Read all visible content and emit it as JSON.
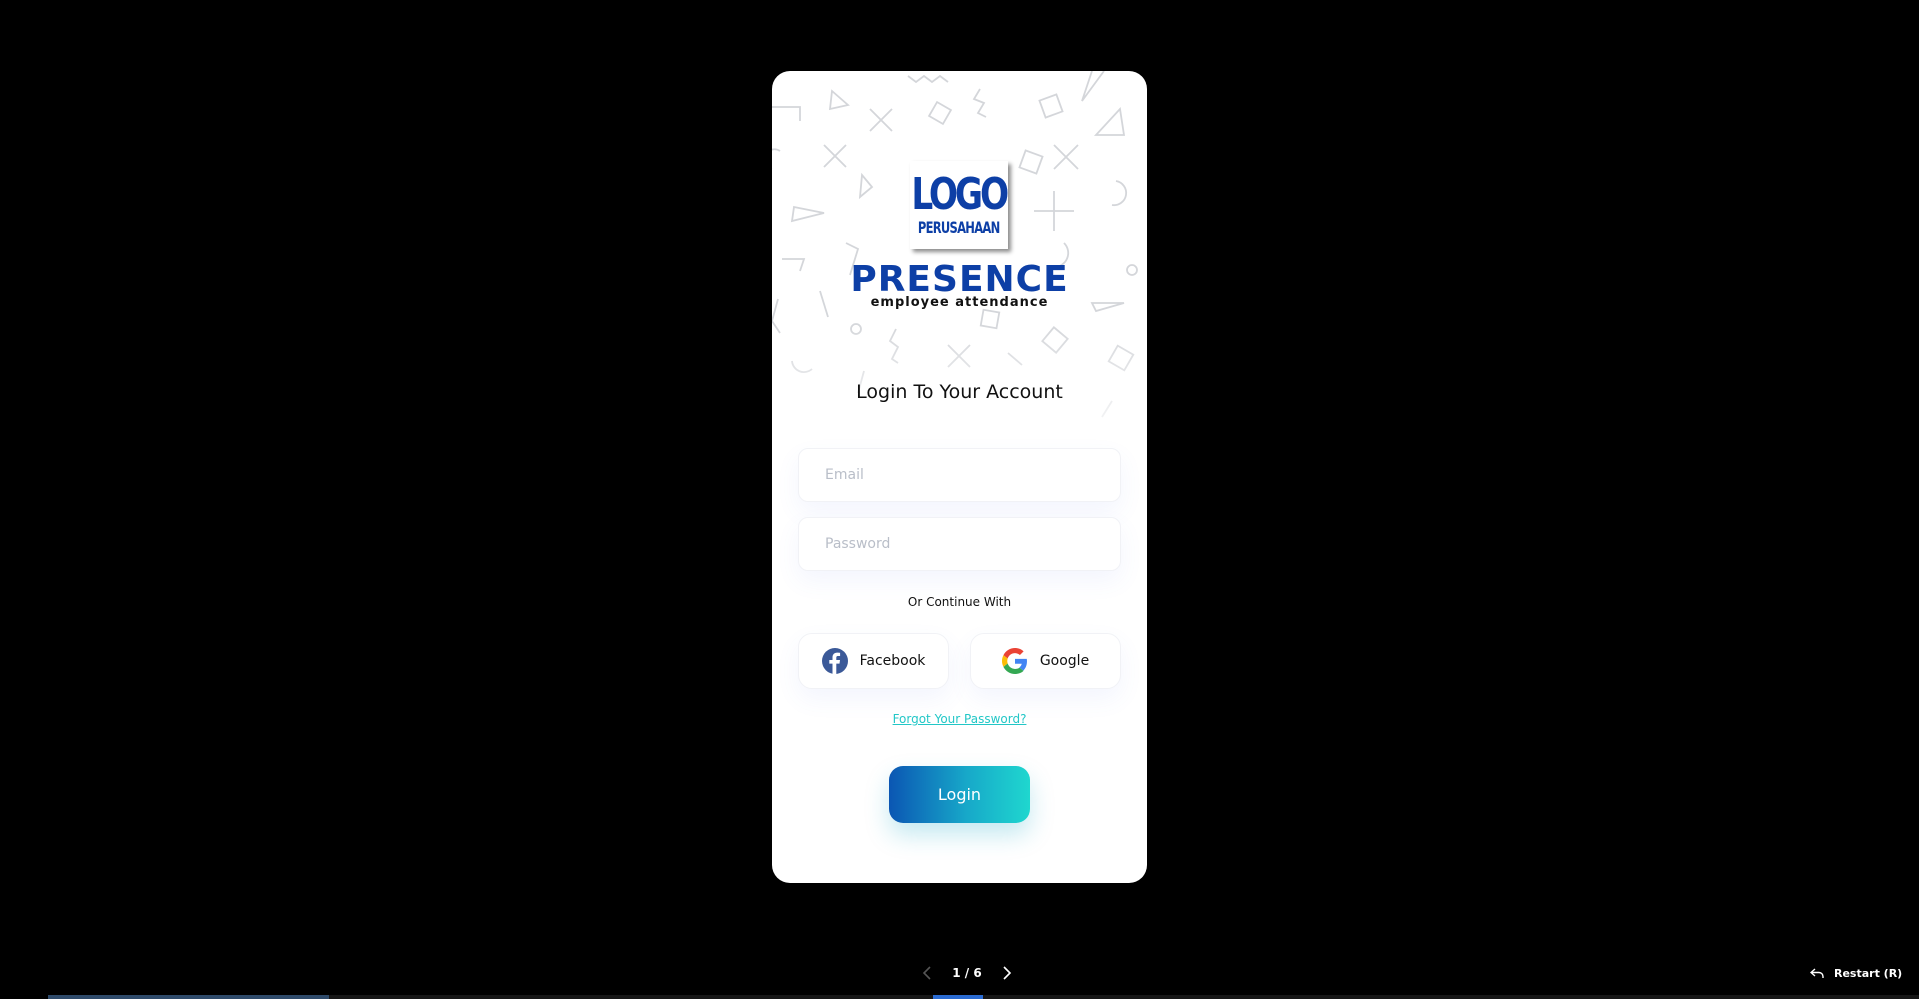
{
  "app": {
    "brand_name": "PRESENCE",
    "brand_tagline": "employee attendance",
    "logo_main": "LOGO",
    "logo_sub": "PERUSAHAAN"
  },
  "login": {
    "heading": "Login To Your Account",
    "email_placeholder": "Email",
    "password_placeholder": "Password",
    "divider_text": "Or Continue With",
    "facebook_label": "Facebook",
    "google_label": "Google",
    "forgot_password": "Forgot Your Password?",
    "login_label": "Login"
  },
  "viewer": {
    "page_indicator": "1 / 6",
    "restart_label": "Restart (R)",
    "progress_fraction": 0.15
  },
  "colors": {
    "brand": "#0d3fa6",
    "accent": "#22c7c7",
    "button_gradient_start": "#0b56b3",
    "button_gradient_end": "#1fd7cf",
    "facebook": "#3b5998"
  },
  "icons": {
    "facebook": "facebook-icon",
    "google": "google-icon",
    "prev": "chevron-left-icon",
    "next": "chevron-right-icon",
    "restart": "restart-icon"
  }
}
